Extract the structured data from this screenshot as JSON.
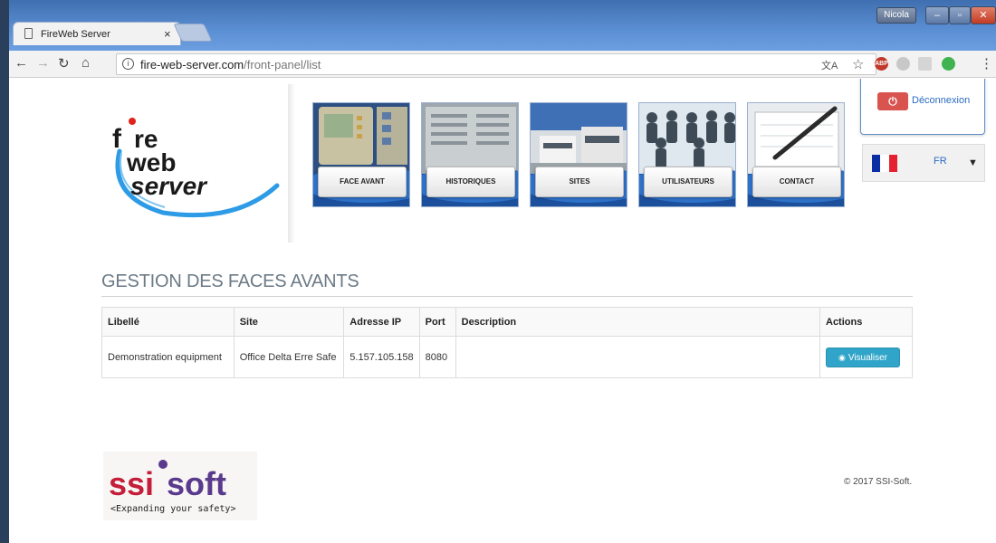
{
  "browser": {
    "tab_title": "FireWeb Server",
    "tab_close": "×",
    "url_host": "fire-web-server.com",
    "url_path": "/front-panel/list",
    "user_name": "Nicola",
    "ext_abp": "ABP"
  },
  "logo": {
    "line1": "f",
    "line1b": "re",
    "line2": "web",
    "line3": "server"
  },
  "nav": {
    "tiles": [
      {
        "label": "FACE AVANT"
      },
      {
        "label": "HISTORIQUES"
      },
      {
        "label": "SITES"
      },
      {
        "label": "UTILISATEURS"
      },
      {
        "label": "CONTACT"
      }
    ]
  },
  "account": {
    "logout_label": "Déconnexion",
    "lang_code": "FR",
    "flag_colors": [
      "#0a2ea4",
      "#ffffff",
      "#e52131"
    ]
  },
  "main": {
    "title": "GESTION DES FACES AVANTS",
    "columns": [
      "Libellé",
      "Site",
      "Adresse IP",
      "Port",
      "Description",
      "Actions"
    ],
    "rows": [
      {
        "libelle": "Demonstration equipment",
        "site": "Office Delta Erre Safe",
        "ip": "5.157.105.158",
        "port": "8080",
        "description": "",
        "action_label": "Visualiser"
      }
    ]
  },
  "footer": {
    "brand_ssi": "ssi",
    "brand_soft": "soft",
    "tagline": "<Expanding your safety>",
    "copyright": "© 2017 SSI-Soft."
  },
  "colors": {
    "accent_blue": "#2a6bc2",
    "danger": "#d9534f",
    "info": "#31a5c9",
    "brand_red": "#c41e3a",
    "brand_purple": "#5a3a8c"
  }
}
